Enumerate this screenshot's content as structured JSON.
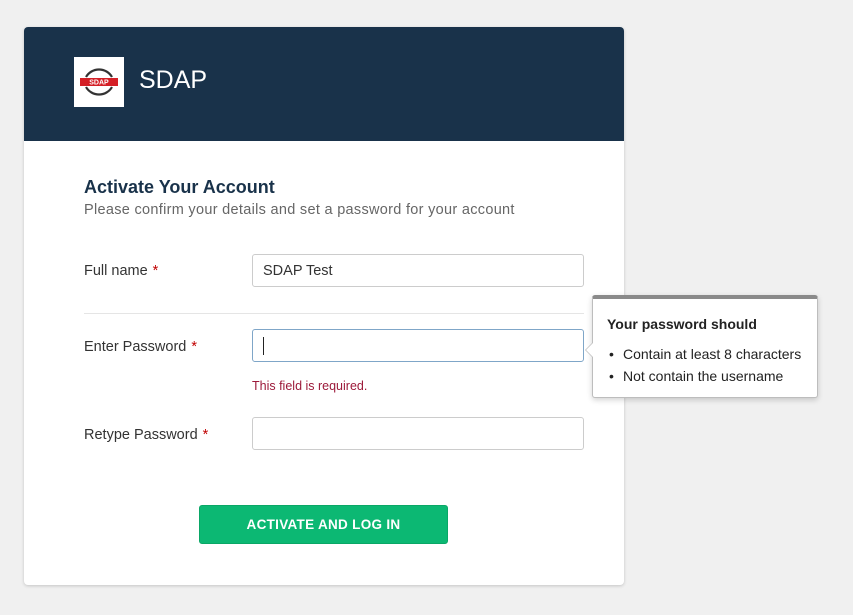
{
  "header": {
    "logo_text": "SDAP",
    "app_title": "SDAP"
  },
  "form": {
    "heading": "Activate Your Account",
    "subheading": "Please confirm your details and set a password for your account",
    "full_name": {
      "label": "Full name",
      "required_mark": "*",
      "value": "SDAP Test"
    },
    "password": {
      "label": "Enter Password",
      "required_mark": "*",
      "value": "",
      "error": "This field is required."
    },
    "retype_password": {
      "label": "Retype Password",
      "required_mark": "*",
      "value": ""
    },
    "submit_label": "ACTIVATE AND LOG IN"
  },
  "tooltip": {
    "title": "Your password should",
    "rules": [
      "Contain at least 8 characters",
      "Not contain the username"
    ]
  },
  "colors": {
    "header_bg": "#19324a",
    "button_bg": "#0cb873",
    "required": "#c00000",
    "error": "#9c1a3a"
  }
}
